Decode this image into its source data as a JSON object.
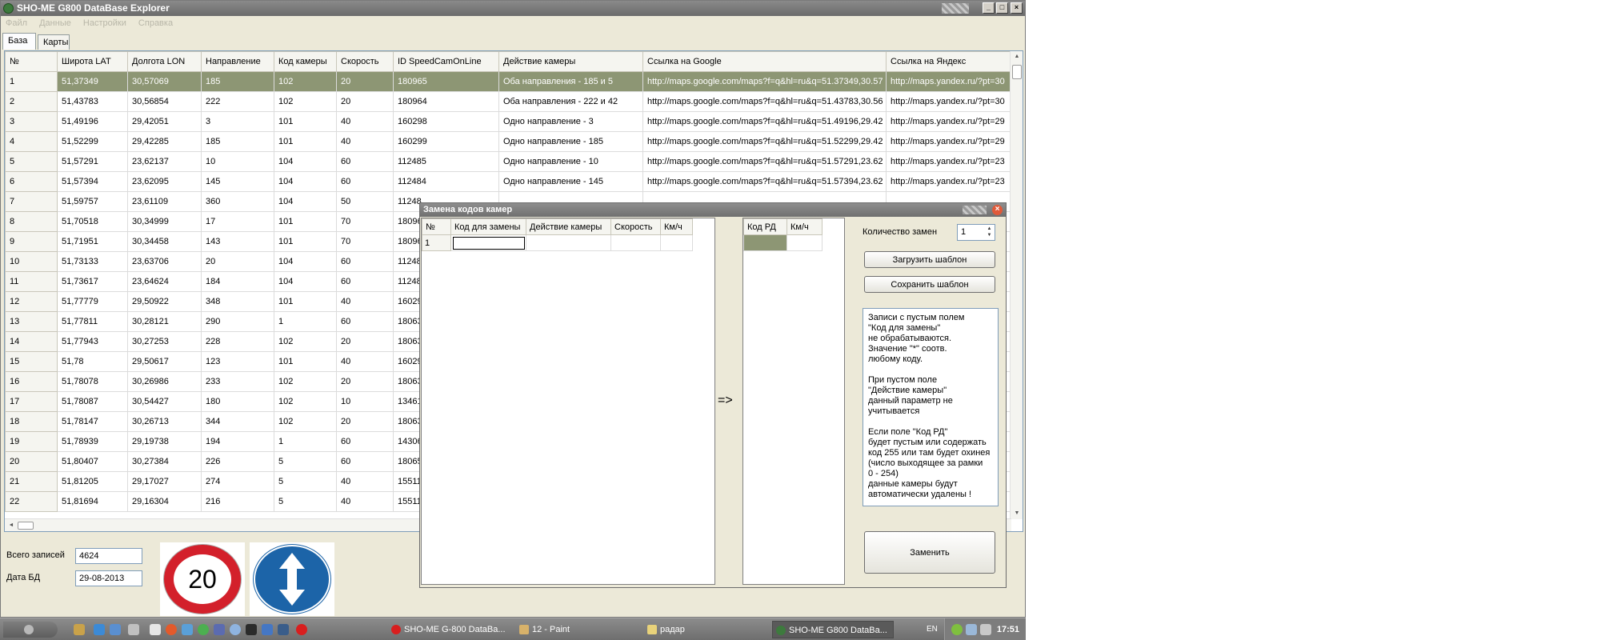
{
  "window": {
    "title": "SHO-ME G800 DataBase Explorer"
  },
  "menu": [
    "Файл",
    "Данные",
    "Настройки",
    "Справка"
  ],
  "tabs": [
    {
      "label": "База"
    },
    {
      "label": "Карты"
    }
  ],
  "table": {
    "columns": [
      "№",
      "Широта LAT",
      "Долгота LON",
      "Направление",
      "Код камеры",
      "Скорость",
      "ID SpeedCamOnLine",
      "Действие камеры",
      "Ссылка на Google",
      "Ссылка на Яндекс"
    ],
    "rows": [
      [
        "1",
        "51,37349",
        "30,57069",
        "185",
        "102",
        "20",
        "180965",
        "Оба направления - 185 и 5",
        "http://maps.google.com/maps?f=q&hl=ru&q=51.37349,30.57",
        "http://maps.yandex.ru/?pt=30"
      ],
      [
        "2",
        "51,43783",
        "30,56854",
        "222",
        "102",
        "20",
        "180964",
        "Оба направления - 222 и 42",
        "http://maps.google.com/maps?f=q&hl=ru&q=51.43783,30.56",
        "http://maps.yandex.ru/?pt=30"
      ],
      [
        "3",
        "51,49196",
        "29,42051",
        "3",
        "101",
        "40",
        "160298",
        "Одно направление - 3",
        "http://maps.google.com/maps?f=q&hl=ru&q=51.49196,29.42",
        "http://maps.yandex.ru/?pt=29"
      ],
      [
        "4",
        "51,52299",
        "29,42285",
        "185",
        "101",
        "40",
        "160299",
        "Одно направление - 185",
        "http://maps.google.com/maps?f=q&hl=ru&q=51.52299,29.42",
        "http://maps.yandex.ru/?pt=29"
      ],
      [
        "5",
        "51,57291",
        "23,62137",
        "10",
        "104",
        "60",
        "112485",
        "Одно направление - 10",
        "http://maps.google.com/maps?f=q&hl=ru&q=51.57291,23.62",
        "http://maps.yandex.ru/?pt=23"
      ],
      [
        "6",
        "51,57394",
        "23,62095",
        "145",
        "104",
        "60",
        "112484",
        "Одно направление - 145",
        "http://maps.google.com/maps?f=q&hl=ru&q=51.57394,23.62",
        "http://maps.yandex.ru/?pt=23"
      ],
      [
        "7",
        "51,59757",
        "23,61109",
        "360",
        "104",
        "50",
        "11248",
        "",
        "",
        ""
      ],
      [
        "8",
        "51,70518",
        "30,34999",
        "17",
        "101",
        "70",
        "18096",
        "",
        "",
        ""
      ],
      [
        "9",
        "51,71951",
        "30,34458",
        "143",
        "101",
        "70",
        "18096",
        "",
        "",
        ""
      ],
      [
        "10",
        "51,73133",
        "23,63706",
        "20",
        "104",
        "60",
        "11248",
        "",
        "",
        ""
      ],
      [
        "11",
        "51,73617",
        "23,64624",
        "184",
        "104",
        "60",
        "11248",
        "",
        "",
        ""
      ],
      [
        "12",
        "51,77779",
        "29,50922",
        "348",
        "101",
        "40",
        "16029",
        "",
        "",
        ""
      ],
      [
        "13",
        "51,77811",
        "30,28121",
        "290",
        "1",
        "60",
        "18063",
        "",
        "",
        ""
      ],
      [
        "14",
        "51,77943",
        "30,27253",
        "228",
        "102",
        "20",
        "18063",
        "",
        "",
        ""
      ],
      [
        "15",
        "51,78",
        "29,50617",
        "123",
        "101",
        "40",
        "16029",
        "",
        "",
        ""
      ],
      [
        "16",
        "51,78078",
        "30,26986",
        "233",
        "102",
        "20",
        "18063",
        "",
        "",
        ""
      ],
      [
        "17",
        "51,78087",
        "30,54427",
        "180",
        "102",
        "10",
        "13461",
        "",
        "",
        ""
      ],
      [
        "18",
        "51,78147",
        "30,26713",
        "344",
        "102",
        "20",
        "18063",
        "",
        "",
        ""
      ],
      [
        "19",
        "51,78939",
        "29,19738",
        "194",
        "1",
        "60",
        "14306",
        "",
        "",
        ""
      ],
      [
        "20",
        "51,80407",
        "30,27384",
        "226",
        "5",
        "60",
        "18065",
        "",
        "",
        ""
      ],
      [
        "21",
        "51,81205",
        "29,17027",
        "274",
        "5",
        "40",
        "15511",
        "",
        "",
        ""
      ],
      [
        "22",
        "51,81694",
        "29,16304",
        "216",
        "5",
        "40",
        "15511",
        "",
        "",
        ""
      ]
    ]
  },
  "stats": {
    "total_label": "Всего записей",
    "total_value": "4624",
    "date_label": "Дата БД",
    "date_value": "29-08-2013"
  },
  "signs": {
    "speed_limit": "20",
    "speed_icon": "speed-limit-sign-icon",
    "twoway_icon": "two-way-traffic-sign-icon"
  },
  "dialog": {
    "title": "Замена кодов камер",
    "left_grid": {
      "columns": [
        "№",
        "Код для замены",
        "Действие камеры",
        "Скорость",
        "Км/ч"
      ],
      "rows": [
        [
          "1",
          "",
          "",
          "",
          ""
        ]
      ]
    },
    "arrow": "=>",
    "right_grid": {
      "columns": [
        "Код РД",
        "Км/ч"
      ],
      "rows": [
        [
          "",
          ""
        ]
      ]
    },
    "count_label": "Количество замен",
    "count_value": "1",
    "load_button": "Загрузить шаблон",
    "save_button": "Сохранить шаблон",
    "info_text": "Записи с пустым полем\n\"Код для замены\"\nне обрабатываются.\nЗначение \"*\" соотв.\nлюбому коду.\n\nПри пустом поле\n\"Действие камеры\"\nданный параметр не\nучитывается\n\nЕсли поле \"Код РД\"\nбудет пустым или содержать\nкод 255 или там будет охинея\n(число выходящее за рамки\n0 - 254)\nданные камеры будут\nавтоматически удалены !",
    "replace_button": "Заменить"
  },
  "taskbar": {
    "tasks": [
      {
        "label": "SHO-ME G-800 DataBa...",
        "icon": "opera-icon",
        "color": "#d81e1e"
      },
      {
        "label": "12 - Paint",
        "icon": "paint-icon",
        "color": "#d8b26a"
      },
      {
        "label": "радар",
        "icon": "folder-icon",
        "color": "#e8d27a"
      },
      {
        "label": "SHO-ME G800 DataBa...",
        "icon": "app-icon",
        "color": "#3d7a3d"
      }
    ],
    "lang": "EN",
    "time": "17:51"
  },
  "colors": {
    "selection": "#8d9674",
    "titlebar": "#7a7a7a"
  }
}
